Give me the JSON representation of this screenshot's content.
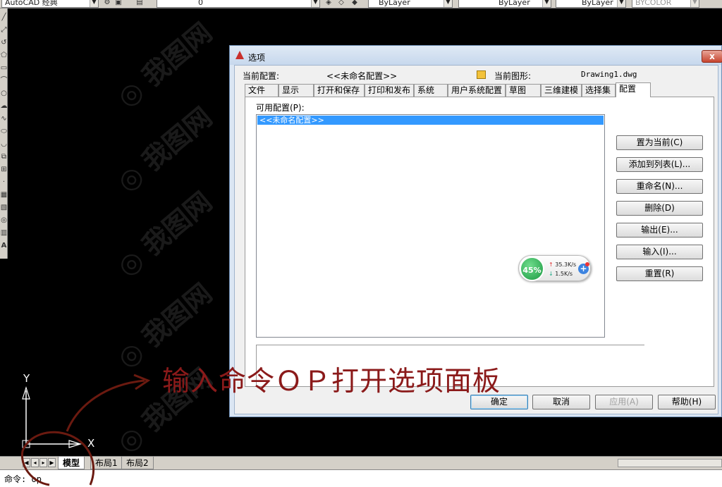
{
  "toolbar": {
    "workspace": "AutoCAD 经典",
    "layer": "0",
    "color": "ByLayer",
    "linetype": "ByLayer",
    "lineweight": "ByLayer",
    "plotstyle": "BYCOLOR"
  },
  "dialog": {
    "title": "选项",
    "current_profile_label": "当前配置:",
    "current_profile_value": "<<未命名配置>>",
    "current_drawing_label": "当前图形:",
    "current_drawing_value": "Drawing1.dwg",
    "close_label": "x",
    "tabs": [
      "文件",
      "显示",
      "打开和保存",
      "打印和发布",
      "系统",
      "用户系统配置",
      "草图",
      "三维建模",
      "选择集",
      "配置"
    ],
    "active_tab": "配置",
    "available_profiles_label": "可用配置(P):",
    "profiles": [
      "<<未命名配置>>"
    ],
    "side_buttons": [
      "置为当前(C)",
      "添加到列表(L)...",
      "重命名(N)...",
      "删除(D)",
      "输出(E)...",
      "输入(I)...",
      "重置(R)"
    ],
    "bottom_buttons": {
      "ok": "确定",
      "cancel": "取消",
      "apply": "应用(A)",
      "help": "帮助(H)"
    }
  },
  "net_widget": {
    "percent": "45%",
    "upload": "35.3K/s",
    "download": "1.5K/s"
  },
  "ucs": {
    "y_label": "Y",
    "x_label": "X"
  },
  "layout_tabs": [
    "模型",
    "布局1",
    "布局2"
  ],
  "command_line": {
    "prompt": "命令:",
    "input": "op"
  },
  "annotation": "输入命令ＯＰ打开选项面板",
  "colors": {
    "annotation": "#8b1a1a",
    "selection": "#3399ff",
    "canvas": "#000000"
  }
}
